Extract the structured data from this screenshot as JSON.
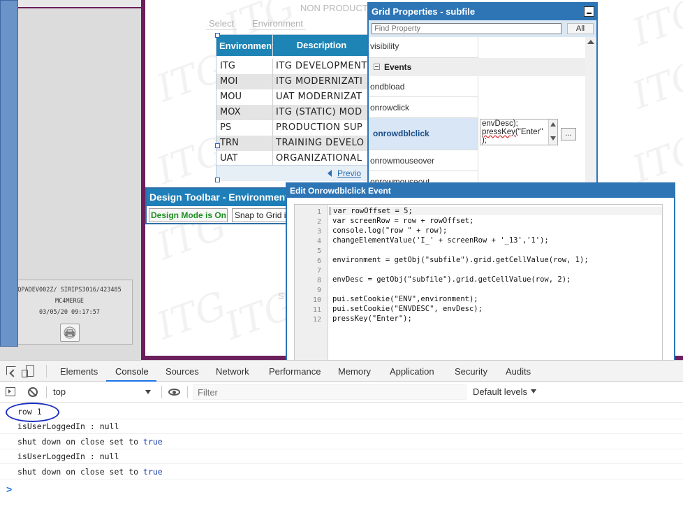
{
  "session": {
    "line1": "QPADEV002Z/ SIRIPS3016/423485",
    "line2": "MC4MERGE",
    "line3": "03/05/20 09:17:57"
  },
  "page": {
    "banner": "NON PRODUCT",
    "select_label": "Select",
    "environment_label": "Environment",
    "watermark": "ITG",
    "stray_char": "S"
  },
  "grid": {
    "headers": [
      "Environment",
      "Description"
    ],
    "rows": [
      [
        "ITG",
        "ITG DEVELOPMENT"
      ],
      [
        "MOI",
        "ITG MODERNIZATI"
      ],
      [
        "MOU",
        "UAT MODERNIZAT"
      ],
      [
        "MOX",
        "ITG (STATIC) MOD"
      ],
      [
        "PS",
        "PRODUCTION SUP"
      ],
      [
        "TRN",
        "TRAINING DEVELO"
      ],
      [
        "UAT",
        "ORGANIZATIONAL"
      ]
    ],
    "prev_label": "Previo"
  },
  "design_toolbar": {
    "title": "Design Toolbar - Environment",
    "design_mode": "Design Mode is On",
    "snap": "Snap to Grid is"
  },
  "grid_properties": {
    "title": "Grid Properties - subfile",
    "find_placeholder": "Find Property",
    "all_button": "All",
    "visibility": "visibility",
    "events_header": "Events",
    "props": [
      "ondbload",
      "onrowclick",
      "onrowdblclick",
      "onrowmouseover",
      "onrowmouseout"
    ],
    "dbl_value_line1": "envDesc);",
    "dbl_value_line2a": "pressKey(",
    "dbl_value_line2b": "\"Enter\"",
    "dbl_value_line3": ");",
    "dots_button": "..."
  },
  "editor": {
    "title": "Edit Onrowdblclick Event",
    "lines": [
      "var rowOffset = 5;",
      "var screenRow = row + rowOffset;",
      "console.log(\"row \" + row);",
      "changeElementValue('I_' + screenRow + '_13','1');",
      "",
      "environment = getObj(\"subfile\").grid.getCellValue(row, 1);",
      "",
      "envDesc = getObj(\"subfile\").grid.getCellValue(row, 2);",
      "",
      "pui.setCookie(\"ENV\",environment);",
      "pui.setCookie(\"ENVDESC\", envDesc);",
      "pressKey(\"Enter\");"
    ],
    "line_numbers": [
      "1",
      "2",
      "3",
      "4",
      "5",
      "6",
      "7",
      "8",
      "9",
      "10",
      "11",
      "12"
    ]
  },
  "devtools": {
    "tabs": [
      "Elements",
      "Console",
      "Sources",
      "Network",
      "Performance",
      "Memory",
      "Application",
      "Security",
      "Audits"
    ],
    "active_tab": "Console",
    "context": "top",
    "filter_placeholder": "Filter",
    "levels": "Default levels",
    "accent": "#1a73e8",
    "log": [
      {
        "text": "row 1"
      },
      {
        "text": "isUserLoggedIn : null"
      },
      {
        "text": "shut down on close set to ",
        "value": "true"
      },
      {
        "text": "isUserLoggedIn : null"
      },
      {
        "text": "shut down on close set to ",
        "value": "true"
      }
    ],
    "prompt": ">"
  },
  "colors": {
    "frame_purple": "#6b1f5c",
    "titlebar_blue": "#2e75b6",
    "grid_header": "#1d84b5",
    "annotation_circle": "#1b2fc0"
  }
}
